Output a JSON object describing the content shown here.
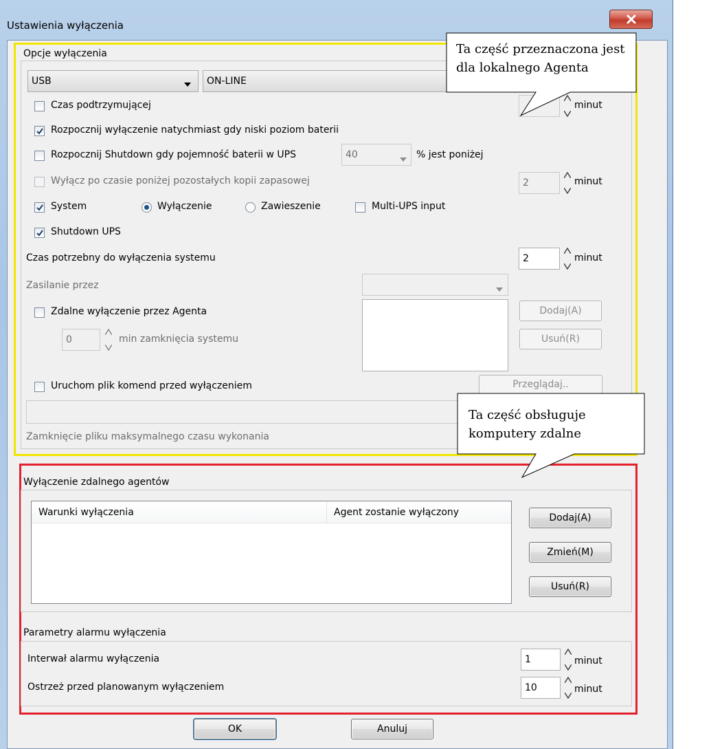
{
  "window": {
    "title": "Ustawienia wyłączenia",
    "close_icon": "close-icon"
  },
  "shutdown_options": {
    "group_title": "Opcje wyłączenia",
    "connection_combo": {
      "value": "USB"
    },
    "status_field": {
      "value": "ON-LINE"
    },
    "backup_time": {
      "label": "Czas podtrzymującej",
      "checked": false,
      "unit": "minut"
    },
    "low_battery": {
      "label": "Rozpocznij wyłączenie natychmiast gdy niski poziom baterii",
      "checked": true
    },
    "capacity": {
      "label": "Rozpocznij Shutdown gdy pojemność baterii w UPS",
      "checked": false,
      "value": "40",
      "suffix": "% jest poniżej"
    },
    "remaining_backup": {
      "label": "Wyłącz po czasie poniżej pozostałych kopii zapasowej",
      "checked": false,
      "value": "2",
      "unit": "minut"
    },
    "system": {
      "label": "System",
      "checked": true
    },
    "radio_shutdown": {
      "label": "Wyłączenie",
      "selected": true
    },
    "radio_suspend": {
      "label": "Zawieszenie",
      "selected": false
    },
    "multi_ups": {
      "label": "Multi-UPS input",
      "checked": false
    },
    "shutdown_ups": {
      "label": "Shutdown UPS",
      "checked": true
    },
    "system_shutdown_time": {
      "label": "Czas potrzebny do wyłączenia systemu",
      "value": "2",
      "unit": "minut"
    },
    "power_via": {
      "label": "Zasilanie przez",
      "value": ""
    },
    "remote_agent": {
      "label": "Zdalne wyłączenie przez Agenta",
      "checked": false,
      "minutes_value": "0",
      "minutes_label": "min zamknięcia systemu"
    },
    "add_button": "Dodaj(A)",
    "remove_button": "Usuń(R)",
    "run_command": {
      "label": "Uruchom plik komend przed wyłączeniem",
      "checked": false,
      "path": ""
    },
    "browse_button": "Przeglądaj..",
    "max_exec_time": {
      "label": "Zamknięcie pliku maksymalnego czasu wykonania"
    }
  },
  "remote_agents": {
    "group_title": "Wyłączenie zdalnego agentów",
    "columns": [
      "Warunki wyłączenia",
      "Agent zostanie wyłączony"
    ],
    "rows": [],
    "add_button": "Dodaj(A)",
    "edit_button": "Zmień(M)",
    "remove_button": "Usuń(R)"
  },
  "alarm_params": {
    "group_title": "Parametry alarmu wyłączenia",
    "interval": {
      "label": "Interwał alarmu wyłączenia",
      "value": "1",
      "unit": "minut"
    },
    "warn_before": {
      "label": "Ostrzeż przed planowanym wyłączeniem",
      "value": "10",
      "unit": "minut"
    }
  },
  "footer": {
    "ok_button": "OK",
    "cancel_button": "Anuluj"
  },
  "callouts": {
    "local_agent": "Ta część przeznaczona jest dla lokalnego Agenta",
    "remote_computers": "Ta część obsługuje komputery zdalne"
  },
  "colors": {
    "local_highlight": "#f2e500",
    "remote_highlight": "#e3202c",
    "close_button": "#c33a2b"
  }
}
